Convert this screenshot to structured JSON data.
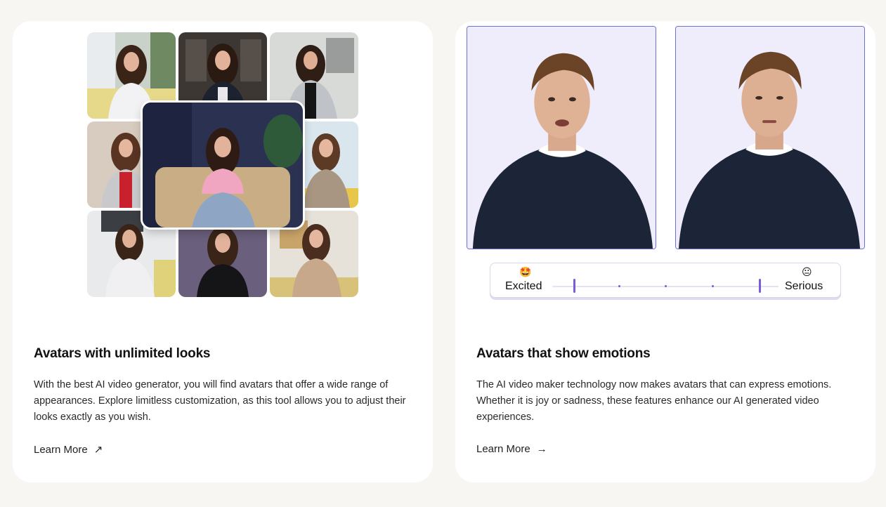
{
  "cards": [
    {
      "title": "Avatars with unlimited looks",
      "description": "With the best AI video generator, you will find avatars that offer a wide range of appearances. Explore limitless customization, as this tool allows you to adjust their looks exactly as you wish.",
      "link_label": "Learn More",
      "link_icon": "arrow-up-right-icon",
      "link_glyph": "↗"
    },
    {
      "title": "Avatars that show emotions",
      "description": "The AI video maker technology now makes avatars that can express emotions. Whether it is joy or sadness, these features enhance our AI generated video experiences.",
      "link_label": "Learn More",
      "link_icon": "arrow-right-icon",
      "link_glyph": "→"
    }
  ],
  "emotion_slider": {
    "left_emoji": "🤩",
    "left_label": "Excited",
    "right_emoji": "😐",
    "right_label": "Serious"
  },
  "colors": {
    "accent": "#7a5cd4",
    "frame_border": "#6b70d6",
    "frame_bg": "#efecfb"
  }
}
